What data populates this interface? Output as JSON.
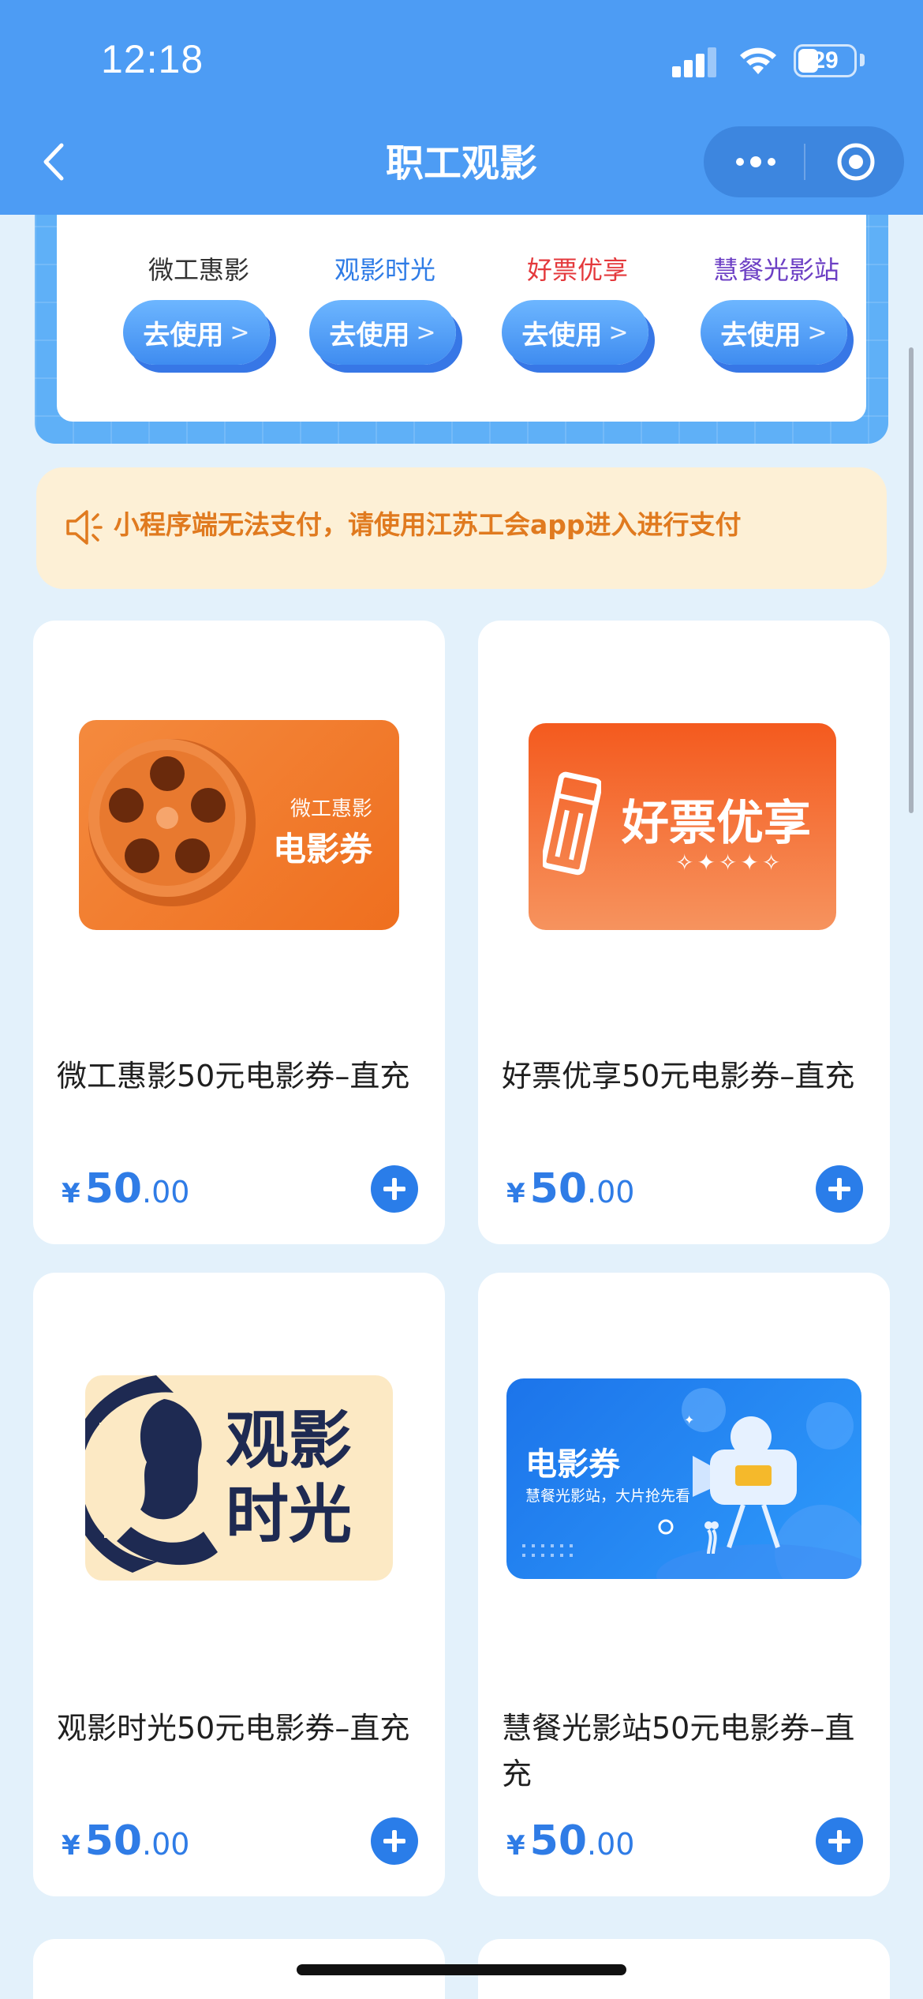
{
  "status_bar": {
    "time": "12:18",
    "battery": "29"
  },
  "nav": {
    "title": "职工观影"
  },
  "shortcuts": [
    {
      "name": "微工惠影",
      "name_color": "#333333",
      "button": "去使用",
      "arrow": ">"
    },
    {
      "name": "观影时光",
      "name_color": "#2f7ce6",
      "button": "去使用",
      "arrow": ">"
    },
    {
      "name": "好票优享",
      "name_color": "#e4393c",
      "button": "去使用",
      "arrow": ">"
    },
    {
      "name": "慧餐光影站",
      "name_color": "#6c3fc4",
      "button": "去使用",
      "arrow": ">"
    }
  ],
  "notice": {
    "text": "小程序端无法支付，请使用江苏工会app进入进行支付"
  },
  "products": [
    {
      "title": "微工惠影50元电影券–直充",
      "thumb_brand": "微工惠影",
      "thumb_label": "电影券",
      "price_symbol": "¥",
      "price_int": "50",
      "price_dec": ".00"
    },
    {
      "title": "好票优享50元电影券–直充",
      "thumb_label": "好票优享",
      "price_symbol": "¥",
      "price_int": "50",
      "price_dec": ".00"
    },
    {
      "title": "观影时光50元电影券–直充",
      "thumb_label_1": "观影",
      "thumb_label_2": "时光",
      "price_symbol": "¥",
      "price_int": "50",
      "price_dec": ".00"
    },
    {
      "title": "慧餐光影站50元电影券–直充",
      "thumb_label": "电影券",
      "thumb_sub": "慧餐光影站，大片抢先看",
      "price_symbol": "¥",
      "price_int": "50",
      "price_dec": ".00"
    }
  ],
  "colors": {
    "nav_bg": "#4d9cf4",
    "accent": "#2a7de9",
    "notice_text": "#e07a1f",
    "page_bg": "#e3f1fb"
  }
}
